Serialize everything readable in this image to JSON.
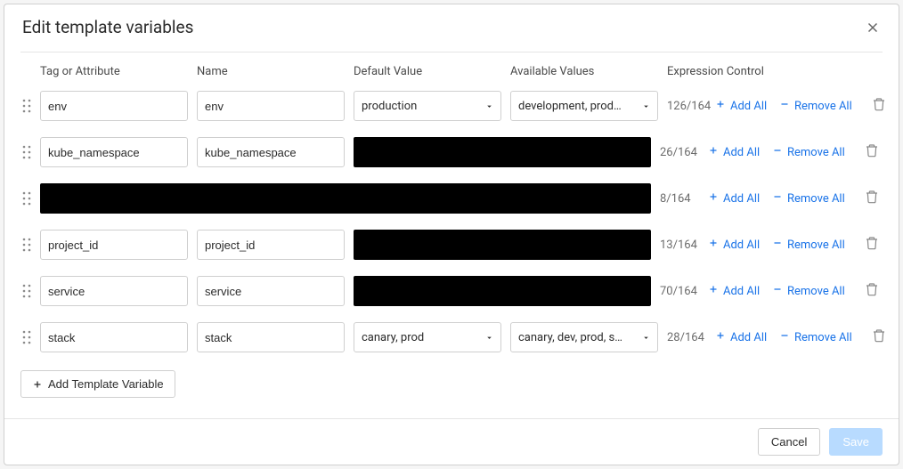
{
  "modal": {
    "title": "Edit template variables"
  },
  "headers": {
    "tag": "Tag or Attribute",
    "name": "Name",
    "default": "Default Value",
    "available": "Available Values",
    "control": "Expression Control"
  },
  "rows": [
    {
      "tag": "env",
      "name": "env",
      "default": "production",
      "available": "development, prod…",
      "count": "126/164",
      "redacted": false,
      "redact_default_avail": false
    },
    {
      "tag": "kube_namespace",
      "name": "kube_namespace",
      "default": "",
      "available": "",
      "count": "26/164",
      "redacted": false,
      "redact_default_avail": true
    },
    {
      "tag": "",
      "name": "",
      "default": "",
      "available": "",
      "count": "8/164",
      "redacted": true,
      "redact_default_avail": true
    },
    {
      "tag": "project_id",
      "name": "project_id",
      "default": "",
      "available": "",
      "count": "13/164",
      "redacted": false,
      "redact_default_avail": true
    },
    {
      "tag": "service",
      "name": "service",
      "default": "",
      "available": "",
      "count": "70/164",
      "redacted": false,
      "redact_default_avail": true
    },
    {
      "tag": "stack",
      "name": "stack",
      "default": "canary, prod",
      "available": "canary, dev, prod, s…",
      "count": "28/164",
      "redacted": false,
      "redact_default_avail": false
    }
  ],
  "buttons": {
    "add_all": "Add All",
    "remove_all": "Remove All",
    "add_template": "Add Template Variable",
    "cancel": "Cancel",
    "save": "Save"
  }
}
